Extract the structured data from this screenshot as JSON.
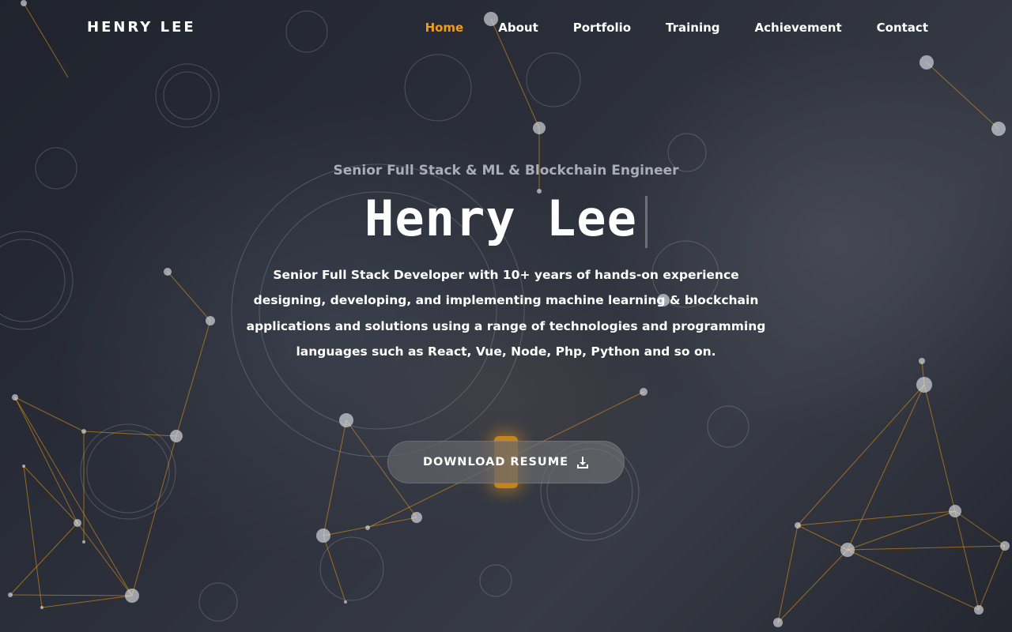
{
  "navbar": {
    "brand": "HENRY LEE",
    "links": [
      {
        "label": "Home",
        "active": true
      },
      {
        "label": "About",
        "active": false
      },
      {
        "label": "Portfolio",
        "active": false
      },
      {
        "label": "Training",
        "active": false
      },
      {
        "label": "Achievement",
        "active": false
      },
      {
        "label": "Contact",
        "active": false
      }
    ]
  },
  "hero": {
    "subtitle": "Senior Full Stack & ML & Blockchain Engineer",
    "name": "Henry Lee",
    "description": "Senior Full Stack Developer with 10+ years of hands-on experience designing, developing, and implementing machine learning & blockchain applications and solutions using a range of technologies and programming languages such as React, Vue, Node, Php, Python and so on.",
    "resume_button": "DOWNLOAD RESUME",
    "resume_icon": "download-icon"
  },
  "colors": {
    "accent": "#f39c12",
    "text": "#ffffff",
    "subtitle": "#a9adb5"
  }
}
